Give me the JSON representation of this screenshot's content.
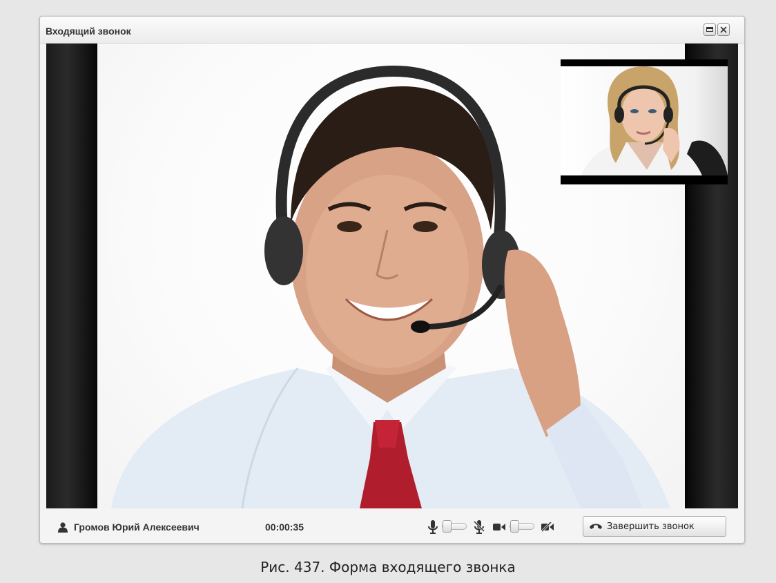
{
  "window": {
    "title": "Входящий звонок",
    "maximize_icon": "maximize-icon",
    "close_icon": "close-icon"
  },
  "video": {
    "remote_alt": "remote-video-feed",
    "local_alt": "local-video-preview"
  },
  "call_bar": {
    "user_icon": "user-icon",
    "caller_name": "Громов Юрий Алексеевич",
    "duration": "00:00:35",
    "mic_icon": "microphone-icon",
    "mic_off_icon": "microphone-off-icon",
    "camera_icon": "camera-icon",
    "camera_off_icon": "camera-off-icon",
    "end_call_label": "Завершить звонок",
    "end_call_icon": "phone-hangup-icon"
  },
  "caption": "Рис. 437. Форма входящего звонка"
}
